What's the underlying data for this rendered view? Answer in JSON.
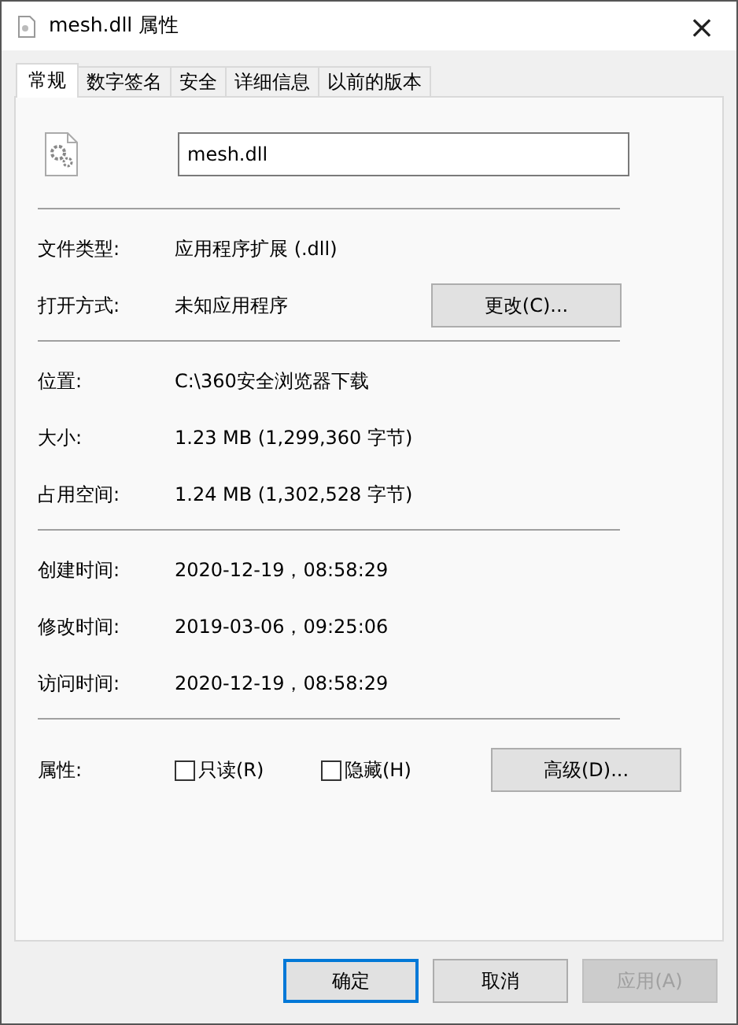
{
  "window": {
    "title": "mesh.dll 属性",
    "close": "×"
  },
  "tabs": [
    {
      "label": "常规",
      "selected": true
    },
    {
      "label": "数字签名",
      "selected": false
    },
    {
      "label": "安全",
      "selected": false
    },
    {
      "label": "详细信息",
      "selected": false
    },
    {
      "label": "以前的版本",
      "selected": false
    }
  ],
  "filename": {
    "value": "mesh.dll"
  },
  "sections": [
    [
      {
        "label": "文件类型:",
        "value": "应用程序扩展 (.dll)"
      },
      {
        "label": "打开方式:",
        "value": "未知应用程序",
        "button": "更改(C)..."
      }
    ],
    [
      {
        "label": "位置:",
        "value": "C:\\360安全浏览器下载"
      },
      {
        "label": "大小:",
        "value": "1.23 MB (1,299,360 字节)"
      },
      {
        "label": "占用空间:",
        "value": "1.24 MB (1,302,528 字节)"
      }
    ],
    [
      {
        "label": "创建时间:",
        "value": "2020-12-19，08:58:29"
      },
      {
        "label": "修改时间:",
        "value": "2019-03-06，09:25:06"
      },
      {
        "label": "访问时间:",
        "value": "2020-12-19，08:58:29"
      }
    ]
  ],
  "attributes": {
    "label": "属性:",
    "checkboxes": [
      {
        "label": "只读(R)",
        "checked": false
      },
      {
        "label": "隐藏(H)",
        "checked": false
      }
    ],
    "button": "高级(D)..."
  },
  "buttons": [
    {
      "label": "确定",
      "kind": "default",
      "disabled": false
    },
    {
      "label": "取消",
      "kind": "normal",
      "disabled": false
    },
    {
      "label": "应用(A)",
      "kind": "normal",
      "disabled": true
    }
  ]
}
